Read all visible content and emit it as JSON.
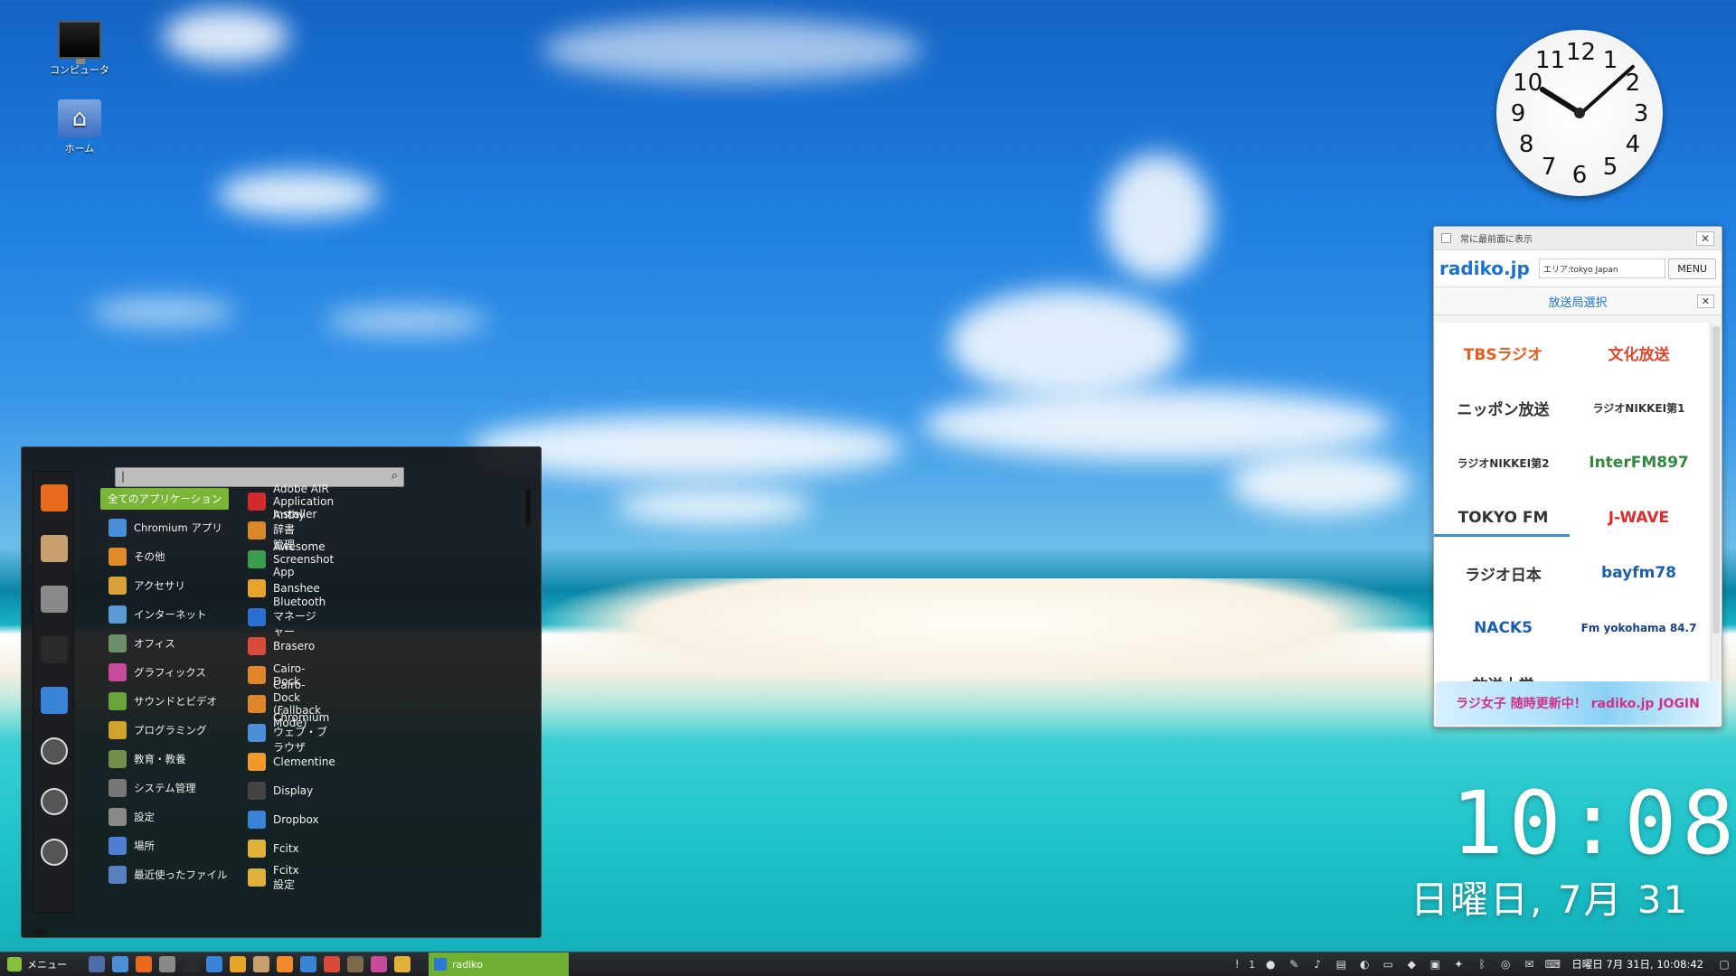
{
  "desktop": {
    "icons": [
      {
        "label": "コンピュータ",
        "icon": "computer-icon"
      },
      {
        "label": "ホーム",
        "icon": "home-folder-icon"
      }
    ]
  },
  "clock": {
    "numerals": [
      "12",
      "1",
      "2",
      "3",
      "4",
      "5",
      "6",
      "7",
      "8",
      "9",
      "10",
      "11"
    ],
    "digital_time": "10:08",
    "digital_date": "日曜日, 7月 31"
  },
  "radiko": {
    "always_on_top": "常に最前面に表示",
    "close": "✕",
    "logo": "radiko.jp",
    "area": "エリア:tokyo Japan",
    "menu_label": "MENU",
    "select_title": "放送局選択",
    "stations": [
      {
        "name": "TBSラジオ",
        "color": "#e85a1d"
      },
      {
        "name": "文化放送",
        "color": "#e2452b"
      },
      {
        "name": "ニッポン放送",
        "color": "#333333"
      },
      {
        "name": "ラジオNIKKEI第1",
        "color": "#333333"
      },
      {
        "name": "ラジオNIKKEI第2",
        "color": "#333333"
      },
      {
        "name": "InterFM897",
        "color": "#2e8b3e"
      },
      {
        "name": "TOKYO FM",
        "color": "#333333"
      },
      {
        "name": "J-WAVE",
        "color": "#e02b2b"
      },
      {
        "name": "ラジオ日本",
        "color": "#333333"
      },
      {
        "name": "bayfm78",
        "color": "#1b5fae"
      },
      {
        "name": "NACK5",
        "color": "#1b5fae"
      },
      {
        "name": "Fm yokohama 84.7",
        "color": "#1b3f8f"
      },
      {
        "name": "放送大学",
        "color": "#333333"
      }
    ],
    "banner": "ラジ女子 随時更新中！ radiko.jp JOGIN"
  },
  "menu": {
    "search_value": "|",
    "favorites": [
      "firefox-icon",
      "package-icon",
      "system-settings-icon",
      "terminal-icon",
      "files-icon",
      "lock-icon",
      "logout-icon",
      "shutdown-icon"
    ],
    "categories": [
      {
        "label": "全てのアプリケーション",
        "active": true,
        "color": "#7ab536",
        "icon": "all-apps-icon"
      },
      {
        "label": "Chromium アプリ",
        "color": "#4a8fd8",
        "icon": "chromium-apps-icon"
      },
      {
        "label": "その他",
        "color": "#e08a2a",
        "icon": "other-icon"
      },
      {
        "label": "アクセサリ",
        "color": "#d9a23a",
        "icon": "accessories-icon"
      },
      {
        "label": "インターネット",
        "color": "#5c9ad6",
        "icon": "internet-icon"
      },
      {
        "label": "オフィス",
        "color": "#6e8f6a",
        "icon": "office-icon"
      },
      {
        "label": "グラフィックス",
        "color": "#c84a9a",
        "icon": "graphics-icon"
      },
      {
        "label": "サウンドとビデオ",
        "color": "#6aa33a",
        "icon": "sound-video-icon"
      },
      {
        "label": "プログラミング",
        "color": "#d3a12e",
        "icon": "programming-icon"
      },
      {
        "label": "教育・教養",
        "color": "#6f8f4a",
        "icon": "education-icon"
      },
      {
        "label": "システム管理",
        "color": "#777777",
        "icon": "system-admin-icon"
      },
      {
        "label": "設定",
        "color": "#888888",
        "icon": "settings-icon"
      },
      {
        "label": "場所",
        "color": "#4f7fd0",
        "icon": "places-icon"
      },
      {
        "label": "最近使ったファイル",
        "color": "#5a7fc0",
        "icon": "recent-files-icon"
      }
    ],
    "apps": [
      {
        "label": "Adobe AIR Application Installer",
        "color": "#d42a2a",
        "icon": "adobe-air-icon"
      },
      {
        "label": "Anthy 辞書管理",
        "color": "#d9892a",
        "icon": "anthy-icon"
      },
      {
        "label": "Awesome Screenshot App",
        "color": "#3b9e4f",
        "icon": "awesome-screenshot-icon"
      },
      {
        "label": "Banshee",
        "color": "#e8a52b",
        "icon": "banshee-icon"
      },
      {
        "label": "Bluetooth マネージャー",
        "color": "#2b6fd3",
        "icon": "bluetooth-icon"
      },
      {
        "label": "Brasero",
        "color": "#d84a3a",
        "icon": "brasero-icon"
      },
      {
        "label": "Cairo-Dock",
        "color": "#e0862a",
        "icon": "cairo-dock-icon"
      },
      {
        "label": "Cairo-Dock (Fallback Mode)",
        "color": "#e0862a",
        "icon": "cairo-dock-fallback-icon"
      },
      {
        "label": "Chromium ウェブ・ブラウザ",
        "color": "#4a8fd8",
        "icon": "chromium-icon"
      },
      {
        "label": "Clementine",
        "color": "#f09a2a",
        "icon": "clementine-icon"
      },
      {
        "label": "Display",
        "color": "#444444",
        "icon": "display-icon"
      },
      {
        "label": "Dropbox",
        "color": "#3a84d8",
        "icon": "dropbox-icon"
      },
      {
        "label": "Fcitx",
        "color": "#e0b23a",
        "icon": "fcitx-icon"
      },
      {
        "label": "Fcitx 設定",
        "color": "#e0b23a",
        "icon": "fcitx-settings-icon"
      }
    ]
  },
  "taskbar": {
    "menu_label": "メニュー",
    "launchers": [
      "show-desktop-icon",
      "chromium-icon",
      "firefox-icon",
      "file-manager-icon",
      "terminal-icon",
      "files-icon",
      "banshee-icon",
      "archive-icon",
      "vlc-icon",
      "dock-icon",
      "system-monitor-icon",
      "gimp-icon",
      "color-picker-icon",
      "network-icon"
    ],
    "window_title": "radiko",
    "tray_count": "1",
    "datetime": "日曜日 7月 31日, 10:08:42"
  }
}
